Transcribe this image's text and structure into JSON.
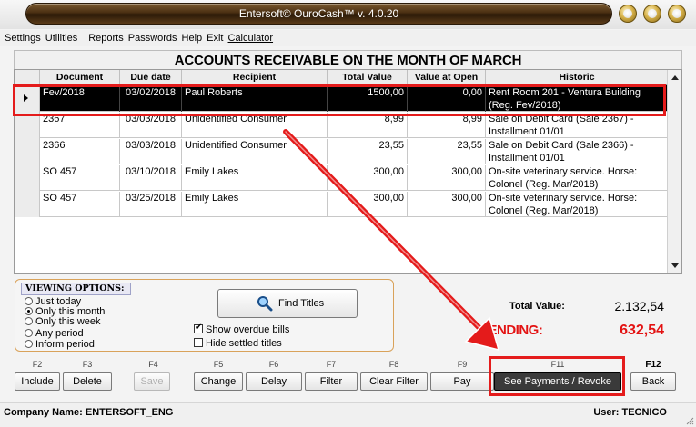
{
  "window": {
    "title": "Entersoft© OuroCash™ v. 4.0.20"
  },
  "menu": [
    "Settings",
    "Utilities",
    "Reports",
    "Passwords",
    "Help",
    "Exit",
    "Calculator"
  ],
  "header": {
    "title": "ACCOUNTS RECEIVABLE ON THE MONTH OF MARCH"
  },
  "grid": {
    "columns": [
      "Document",
      "Due date",
      "Recipient",
      "Total Value",
      "Value at Open",
      "Historic"
    ],
    "rows": [
      {
        "document": "Fev/2018",
        "due": "03/02/2018",
        "recipient": "Paul Roberts",
        "total": "1500,00",
        "open": "0,00",
        "historic1": "Rent Room 201 - Ventura Building",
        "historic2": "(Reg. Fev/2018)"
      },
      {
        "document": "2367",
        "due": "03/03/2018",
        "recipient": "Unidentified Consumer",
        "total": "8,99",
        "open": "8,99",
        "historic1": "Sale on Debit Card (Sale 2367) -",
        "historic2": "Installment 01/01"
      },
      {
        "document": "2366",
        "due": "03/03/2018",
        "recipient": "Unidentified Consumer",
        "total": "23,55",
        "open": "23,55",
        "historic1": "Sale on Debit Card (Sale 2366) -",
        "historic2": "Installment 01/01"
      },
      {
        "document": "SO 457",
        "due": "03/10/2018",
        "recipient": "Emily Lakes",
        "total": "300,00",
        "open": "300,00",
        "historic1": "On-site veterinary service. Horse:",
        "historic2": "Colonel (Reg. Mar/2018)"
      },
      {
        "document": "SO 457",
        "due": "03/25/2018",
        "recipient": "Emily Lakes",
        "total": "300,00",
        "open": "300,00",
        "historic1": "On-site veterinary service. Horse:",
        "historic2": "Colonel (Reg. Mar/2018)"
      }
    ]
  },
  "viewing": {
    "title": "VIEWING OPTIONS:",
    "options": [
      "Just today",
      "Only this month",
      "Only this week",
      "Any period",
      "Inform period"
    ],
    "selected": "Only this month",
    "find_label": "Find Titles",
    "show_overdue_label": "Show overdue bills",
    "show_overdue_checked": true,
    "hide_settled_label": "Hide settled titles",
    "hide_settled_checked": false
  },
  "totals": {
    "total_label": "Total Value:",
    "total_value": "2.132,54",
    "pending_label": "PENDING:",
    "pending_value": "632,54"
  },
  "fkeys": [
    {
      "key": "F2",
      "label": "Include"
    },
    {
      "key": "F3",
      "label": "Delete"
    },
    {
      "key": "F4",
      "label": "Save",
      "disabled": true
    },
    {
      "key": "F5",
      "label": "Change"
    },
    {
      "key": "F6",
      "label": "Delay"
    },
    {
      "key": "F7",
      "label": "Filter"
    },
    {
      "key": "F8",
      "label": "Clear Filter"
    },
    {
      "key": "F9",
      "label": "Pay"
    },
    {
      "key": "F11",
      "label": "See Payments / Revoke",
      "active": true
    },
    {
      "key": "F12",
      "label": "Back"
    }
  ],
  "status": {
    "company": "Company Name: ENTERSOFT_ENG",
    "user": "User: TECNICO"
  },
  "colors": {
    "pending": "#e31212",
    "annotation": "#e41b1b",
    "titlebar": "#4a2f12"
  }
}
